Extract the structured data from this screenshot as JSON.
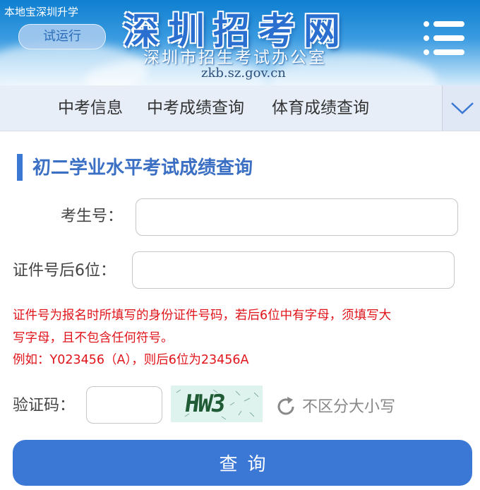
{
  "header": {
    "caption": "本地宝深圳升学",
    "badge": "试运行",
    "title": "深圳招考网",
    "subtitle": "深圳市招生考试办公室",
    "domain": "zkb.sz.gov.cn"
  },
  "nav": {
    "items": [
      {
        "label": "中考信息"
      },
      {
        "label": "中考成绩查询"
      },
      {
        "label": "体育成绩查询"
      }
    ]
  },
  "form": {
    "title": "初二学业水平考试成绩查询",
    "fields": {
      "exam_no": {
        "label": "考生号：",
        "value": ""
      },
      "id_last6": {
        "label": "证件号后6位：",
        "value": ""
      },
      "captcha": {
        "label": "验证码：",
        "value": ""
      }
    },
    "notes": [
      "证件号为报名时所填写的身份证件号码，若后6位中有字母，须填写大",
      "写字母，且不包含任何符号。",
      "例如：Y023456（A），则后6位为23456A"
    ],
    "captcha_text": "HW3",
    "case_note": "不区分大小写",
    "submit_label": "查询"
  },
  "colors": {
    "accent": "#3b78d6",
    "title": "#3a6fc4",
    "warning": "#e0141b",
    "nav_bg": "#e8eef8"
  }
}
